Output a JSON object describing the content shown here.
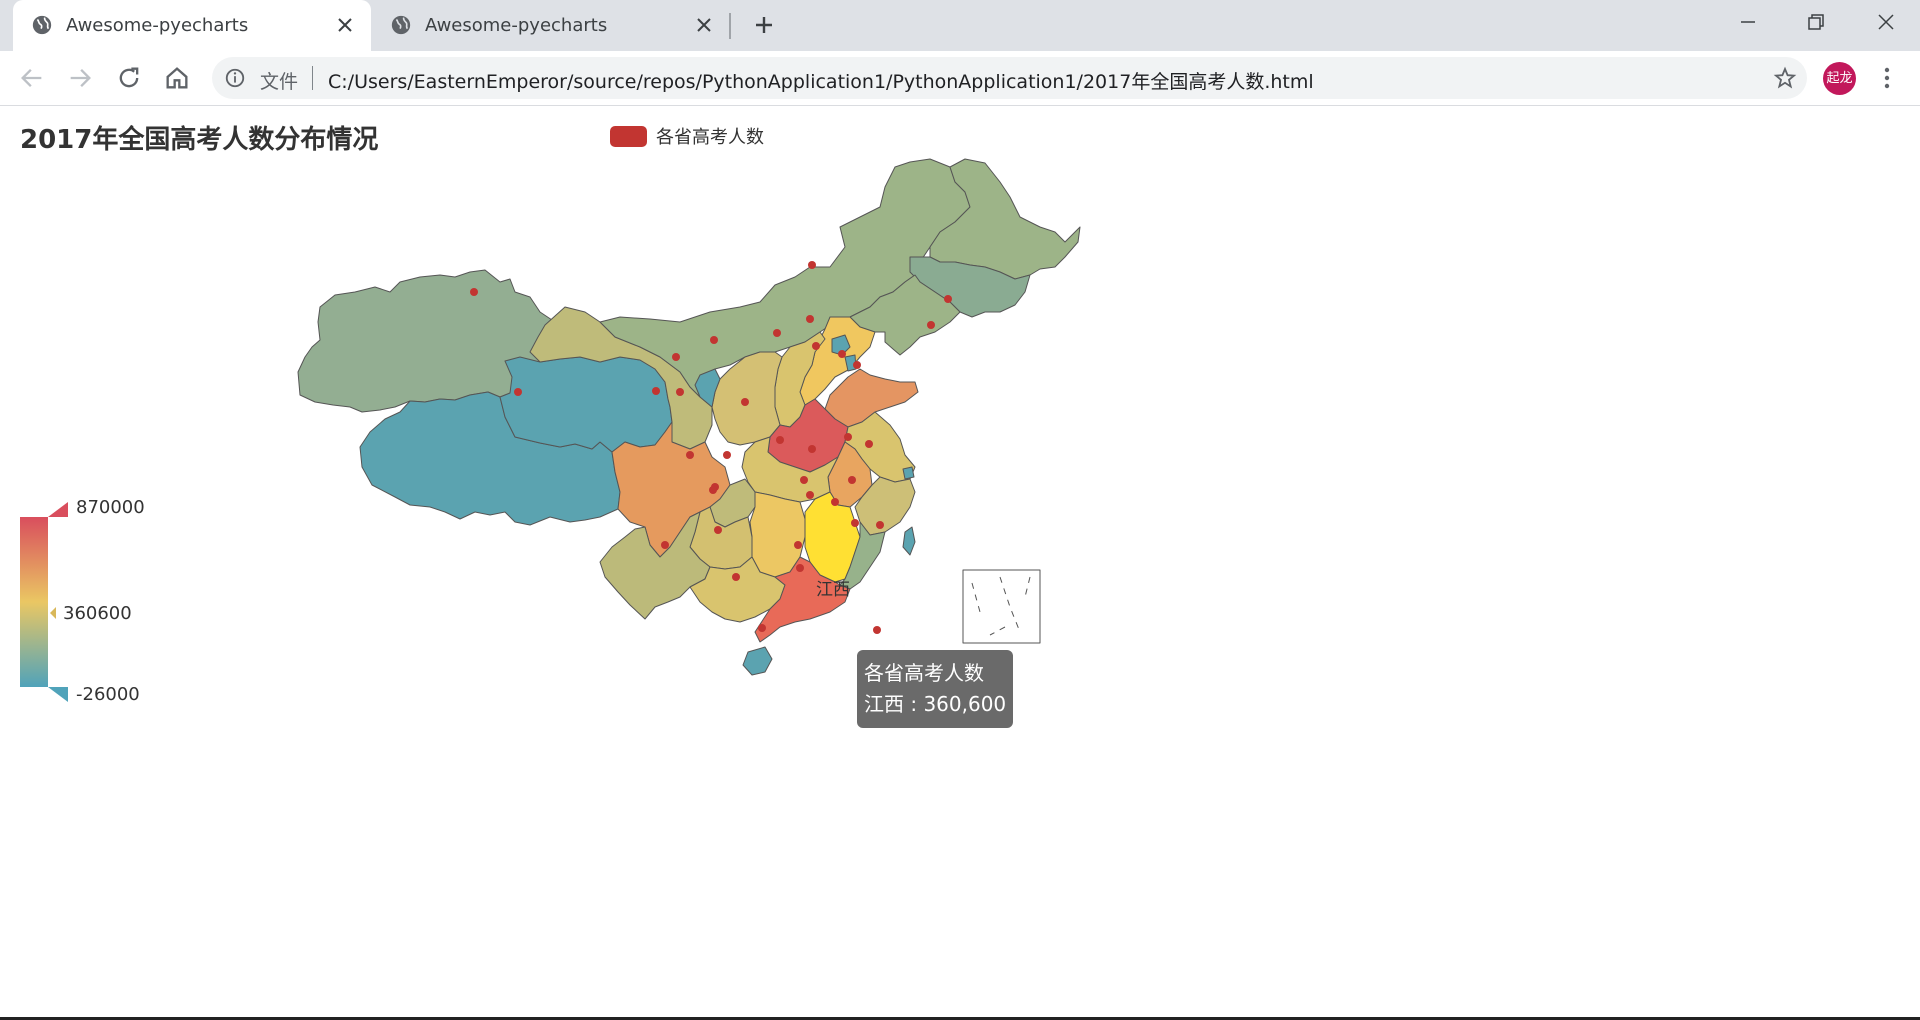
{
  "browser": {
    "tabs": [
      {
        "title": "Awesome-pyecharts",
        "active": true
      },
      {
        "title": "Awesome-pyecharts",
        "active": false
      }
    ],
    "address": {
      "scheme_label": "文件",
      "url": "C:/Users/EasternEmperor/source/repos/PythonApplication1/PythonApplication1/2017年全国高考人数.html"
    },
    "profile_avatar_text": "起龙",
    "icons": {
      "tab_favicon": "globe-icon",
      "tab_close": "close-icon",
      "new_tab": "plus-icon",
      "back": "arrow-left-icon",
      "forward": "arrow-right-icon",
      "reload": "reload-icon",
      "home": "home-icon",
      "site_info": "info-icon",
      "bookmark": "star-icon",
      "menu": "vertical-dots-icon"
    }
  },
  "chart_data": {
    "type": "map",
    "title": "2017年全国高考人数分布情况",
    "legend": [
      "各省高考人数"
    ],
    "visual_map": {
      "max_label": "870000",
      "mid_label": "360600",
      "min_label": "-26000",
      "max": 870000,
      "min": -26000,
      "indicator": 360600,
      "colors": [
        "#50a3ba",
        "#eac763",
        "#d94e5d"
      ]
    },
    "highlighted_region": {
      "name": "江西",
      "label": "江西"
    },
    "tooltip": {
      "series": "各省高考人数",
      "text": "江西 : 360,600"
    }
  },
  "colors": {
    "legend_swatch": "#c23531",
    "marker": "#c23531",
    "highlight": "#ffe033",
    "border": "#555555"
  }
}
